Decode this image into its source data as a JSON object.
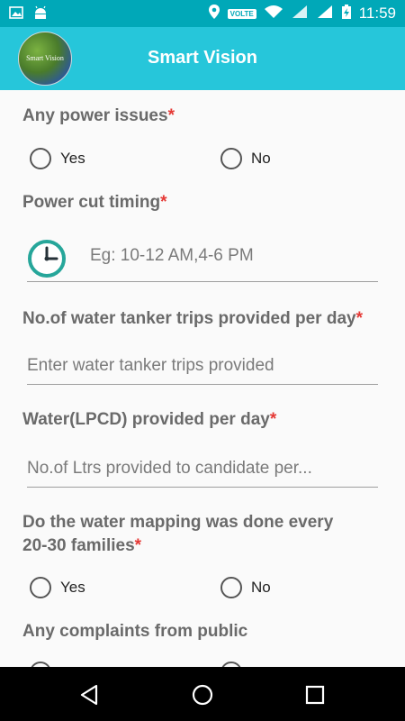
{
  "status_bar": {
    "time": "11:59",
    "volte": "VOLTE",
    "icons": [
      "image-icon",
      "android-icon",
      "location-icon",
      "wifi-icon",
      "signal-lte-icon",
      "signal-h-icon",
      "battery-charging-icon"
    ]
  },
  "app_bar": {
    "title": "Smart Vision",
    "logo_text": "Smart Vision"
  },
  "form": {
    "q_power_issues": {
      "label": "Any power issues",
      "required": "*",
      "options": [
        "Yes",
        "No"
      ]
    },
    "q_power_cut": {
      "label": "Power cut timing",
      "required": "*",
      "placeholder": "Eg: 10-12 AM,4-6 PM"
    },
    "q_tanker_trips": {
      "label": "No.of water tanker trips provided per day",
      "required": "*",
      "placeholder": "Enter water tanker trips provided"
    },
    "q_lpcd": {
      "label": "Water(LPCD) provided per day",
      "required": "*",
      "placeholder": "No.of Ltrs provided to candidate per..."
    },
    "q_mapping": {
      "label_line1": "Do the water mapping was done every",
      "label_line2": "20-30 families",
      "required": "*",
      "options": [
        "Yes",
        "No"
      ]
    },
    "q_complaints": {
      "label": "Any complaints from public"
    }
  },
  "colors": {
    "status_bar": "#00A8B8",
    "app_bar": "#26C6DA",
    "required": "#e53935",
    "clock_teal": "#26A69A"
  }
}
